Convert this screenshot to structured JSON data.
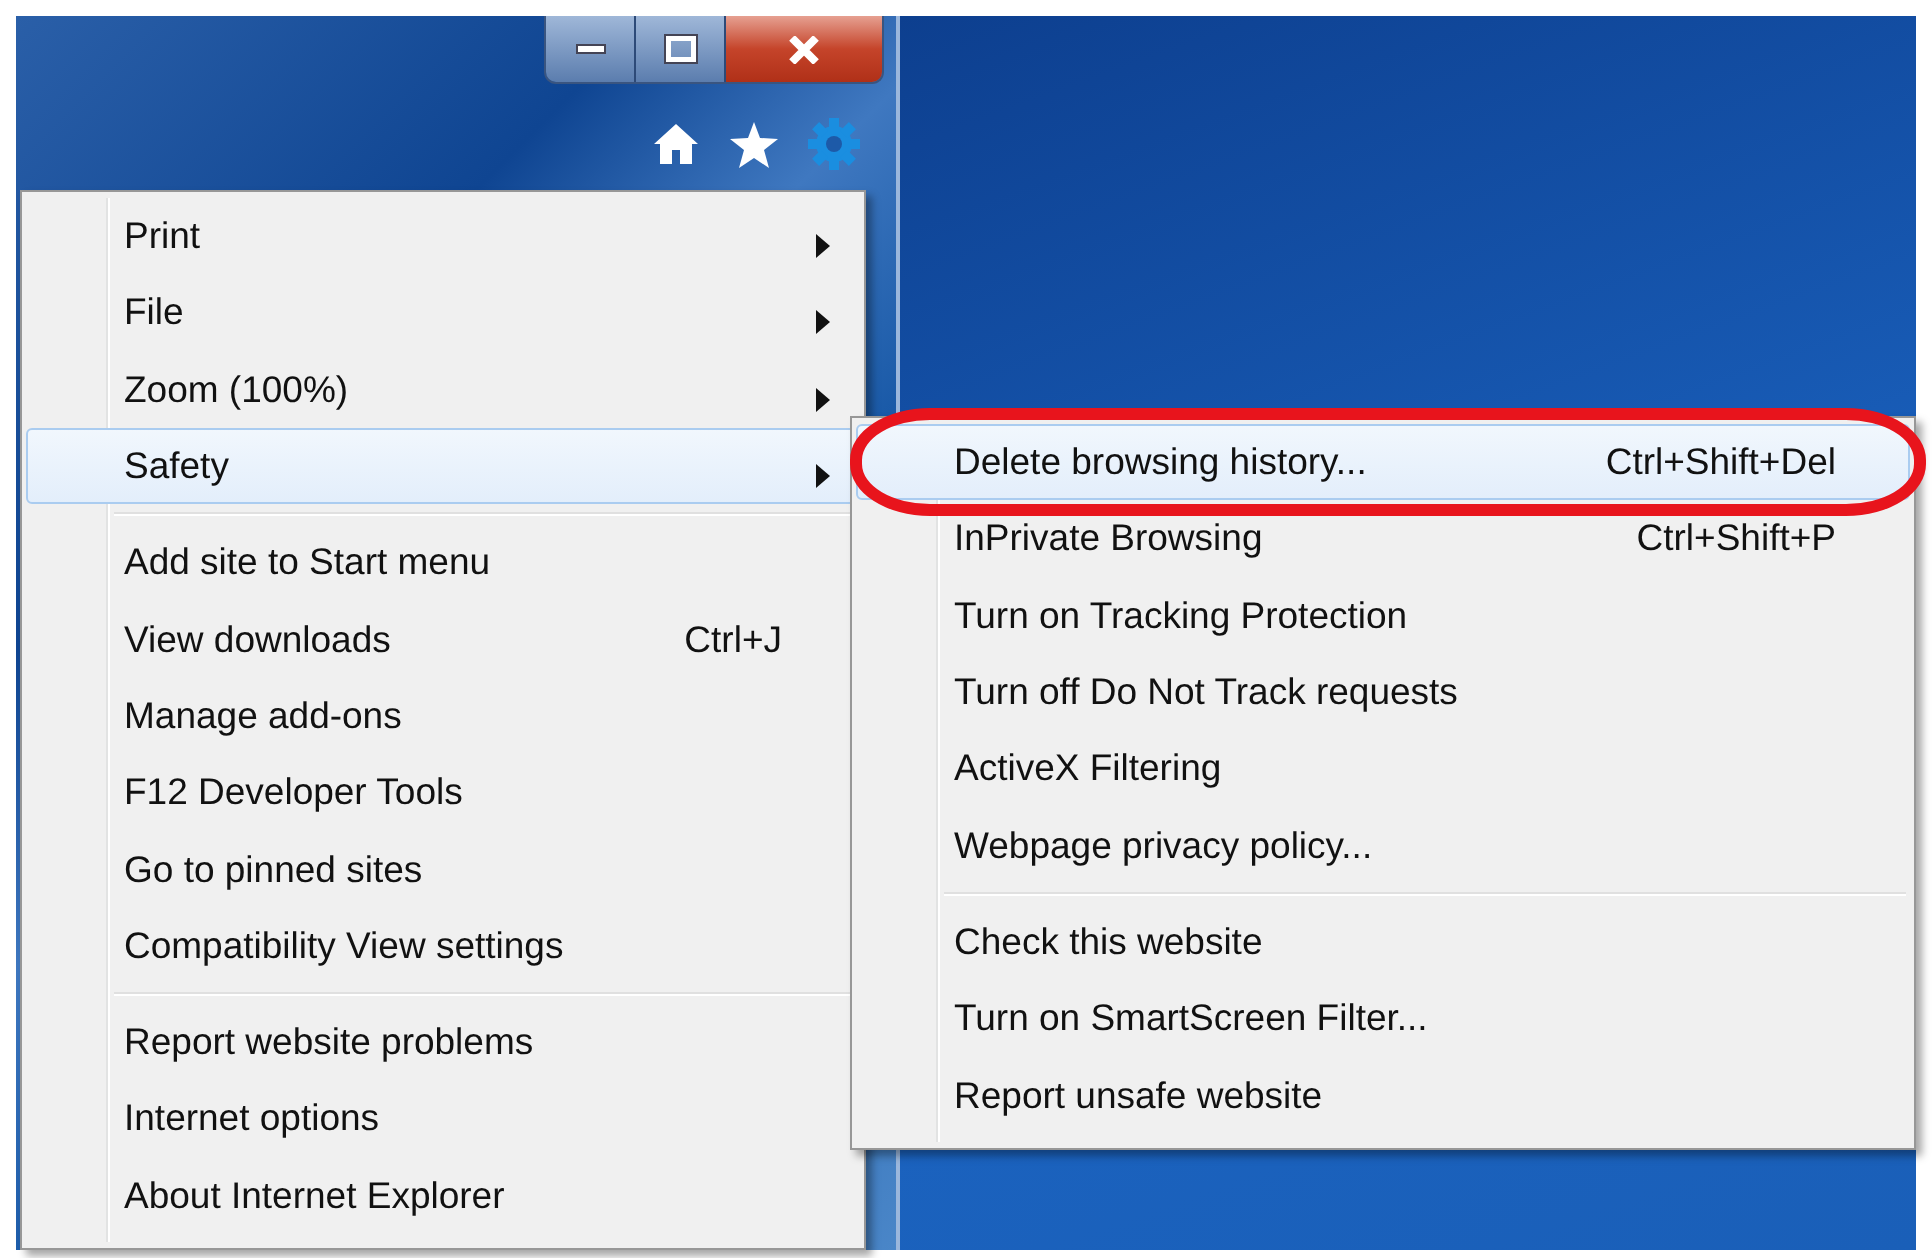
{
  "window": {
    "caption_buttons": [
      {
        "kind": "minimize"
      },
      {
        "kind": "maximize"
      },
      {
        "kind": "close"
      }
    ],
    "toolbar_icons": [
      {
        "kind": "home"
      },
      {
        "kind": "favorites"
      },
      {
        "kind": "tools"
      }
    ]
  },
  "tools_menu": {
    "items": [
      {
        "kind": "item",
        "label": "Print",
        "has_submenu": true,
        "selected": false
      },
      {
        "kind": "item",
        "label": "File",
        "has_submenu": true,
        "selected": false
      },
      {
        "kind": "item",
        "label": "Zoom (100%)",
        "has_submenu": true,
        "selected": false
      },
      {
        "kind": "item",
        "label": "Safety",
        "has_submenu": true,
        "selected": true
      },
      {
        "kind": "separator"
      },
      {
        "kind": "item",
        "label": "Add site to Start menu",
        "has_submenu": false,
        "selected": false
      },
      {
        "kind": "item",
        "label": "View downloads",
        "shortcut": "Ctrl+J",
        "has_submenu": false,
        "selected": false
      },
      {
        "kind": "item",
        "label": "Manage add-ons",
        "has_submenu": false,
        "selected": false
      },
      {
        "kind": "item",
        "label": "F12 Developer Tools",
        "has_submenu": false,
        "selected": false
      },
      {
        "kind": "item",
        "label": "Go to pinned sites",
        "has_submenu": false,
        "selected": false
      },
      {
        "kind": "item",
        "label": "Compatibility View settings",
        "has_submenu": false,
        "selected": false
      },
      {
        "kind": "separator"
      },
      {
        "kind": "item",
        "label": "Report website problems",
        "has_submenu": false,
        "selected": false
      },
      {
        "kind": "item",
        "label": "Internet options",
        "has_submenu": false,
        "selected": false
      },
      {
        "kind": "item",
        "label": "About Internet Explorer",
        "has_submenu": false,
        "selected": false
      }
    ]
  },
  "safety_submenu": {
    "items": [
      {
        "kind": "item",
        "label": "Delete browsing history...",
        "shortcut": "Ctrl+Shift+Del",
        "has_submenu": false,
        "selected": true,
        "circled": true
      },
      {
        "kind": "item",
        "label": "InPrivate Browsing",
        "shortcut": "Ctrl+Shift+P",
        "has_submenu": false,
        "selected": false,
        "circled": false
      },
      {
        "kind": "item",
        "label": "Turn on Tracking Protection",
        "has_submenu": false,
        "selected": false,
        "circled": false
      },
      {
        "kind": "item",
        "label": "Turn off Do Not Track requests",
        "has_submenu": false,
        "selected": false,
        "circled": false
      },
      {
        "kind": "item",
        "label": "ActiveX Filtering",
        "has_submenu": false,
        "selected": false,
        "circled": false
      },
      {
        "kind": "item",
        "label": "Webpage privacy policy...",
        "has_submenu": false,
        "selected": false,
        "circled": false
      },
      {
        "kind": "separator"
      },
      {
        "kind": "item",
        "label": "Check this website",
        "has_submenu": false,
        "selected": false,
        "circled": false
      },
      {
        "kind": "item",
        "label": "Turn on SmartScreen Filter...",
        "has_submenu": false,
        "selected": false,
        "circled": false
      },
      {
        "kind": "item",
        "label": "Report unsafe website",
        "has_submenu": false,
        "selected": false,
        "circled": false
      }
    ]
  }
}
